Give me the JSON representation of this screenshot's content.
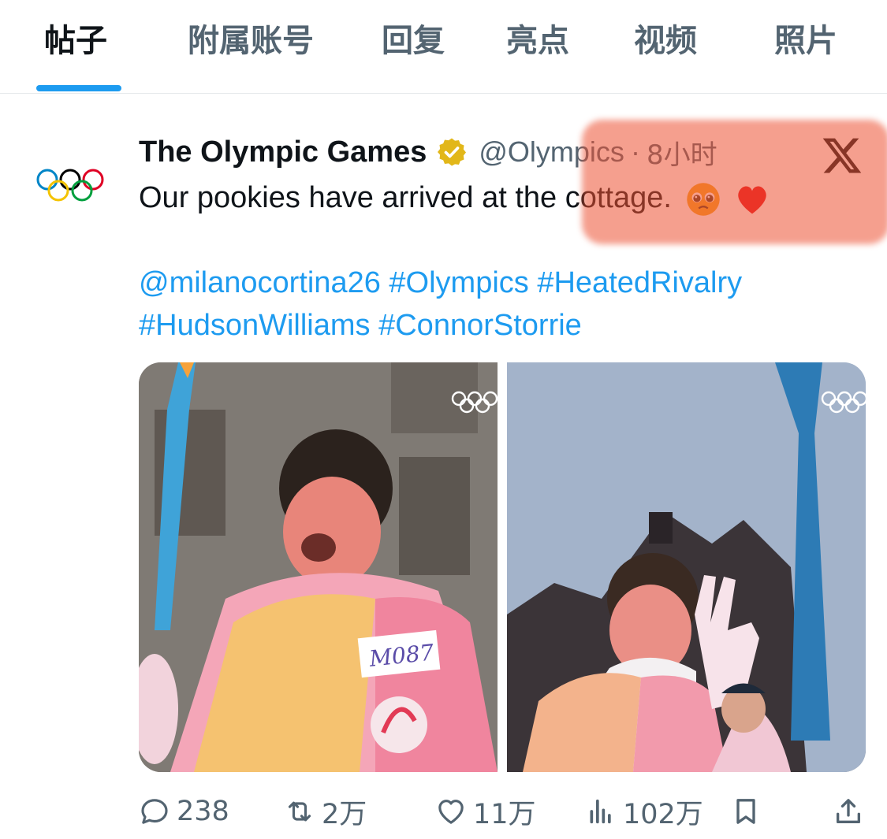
{
  "tabs": {
    "items": [
      "帖子",
      "附属账号",
      "回复",
      "亮点",
      "视频",
      "照片"
    ]
  },
  "post": {
    "display_name": "The Olympic Games",
    "handle": "@Olympics",
    "separator": "·",
    "time": "8小时",
    "text": "Our pookies have arrived at the cottage.",
    "mentions": [
      "@milanocortina26",
      "#Olympics",
      "#HeatedRivalry",
      "#HudsonWilliams",
      "#ConnorStorrie"
    ],
    "bib_number": "M087"
  },
  "stats": {
    "replies": "238",
    "reposts": "2万",
    "likes": "11万",
    "views": "102万"
  },
  "colors": {
    "accent": "#1d9bf0",
    "text": "#0f1419",
    "muted": "#536471",
    "highlight": "#ec5032"
  }
}
